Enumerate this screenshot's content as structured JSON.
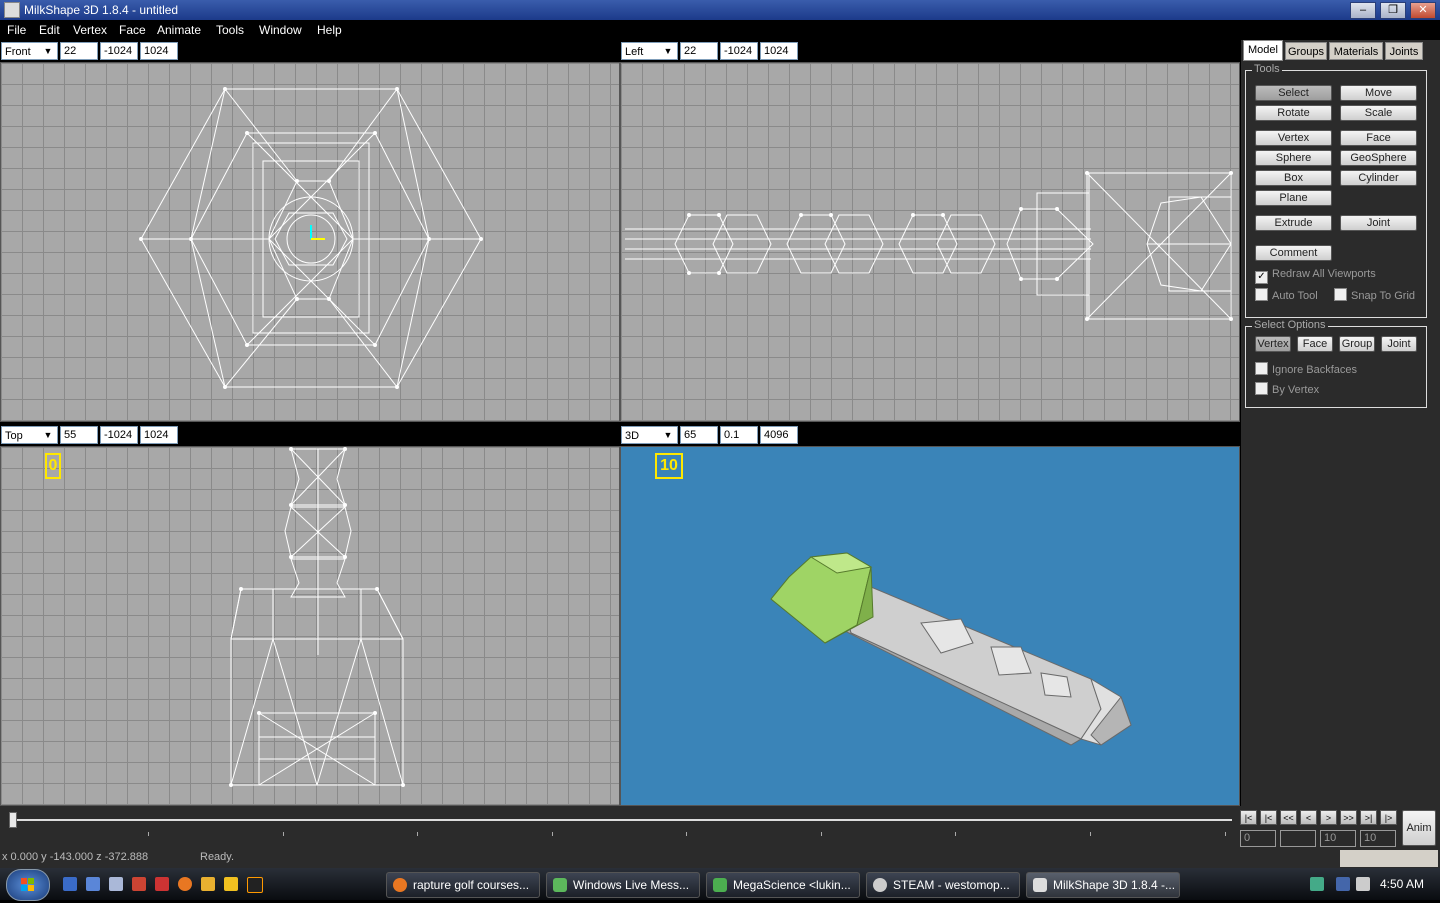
{
  "window": {
    "title": "MilkShape 3D 1.8.4 - untitled"
  },
  "menu": [
    "File",
    "Edit",
    "Vertex",
    "Face",
    "Animate",
    "Tools",
    "Window",
    "Help"
  ],
  "viewports": {
    "front": {
      "mode": "Front",
      "f1": "22",
      "f2": "-1024",
      "f3": "1024"
    },
    "left": {
      "mode": "Left",
      "f1": "22",
      "f2": "-1024",
      "f3": "1024"
    },
    "top": {
      "mode": "Top",
      "f1": "55",
      "f2": "-1024",
      "f3": "1024",
      "frame": "0"
    },
    "persp": {
      "mode": "3D",
      "f1": "65",
      "f2": "0.1",
      "f3": "4096",
      "frame": "10"
    }
  },
  "panel": {
    "tabs": [
      "Model",
      "Groups",
      "Materials",
      "Joints"
    ],
    "tools_label": "Tools",
    "tools": [
      "Select",
      "Move",
      "Rotate",
      "Scale",
      "Vertex",
      "Face",
      "Sphere",
      "GeoSphere",
      "Box",
      "Cylinder",
      "Plane",
      "Extrude",
      "Joint",
      "Comment"
    ],
    "checks": [
      "Redraw All Viewports",
      "Auto Tool",
      "Snap To Grid"
    ],
    "select_label": "Select Options",
    "select_buttons": [
      "Vertex",
      "Face",
      "Group",
      "Joint"
    ],
    "select_checks": [
      "Ignore Backfaces",
      "By Vertex"
    ]
  },
  "timeline": {
    "fields": [
      "0",
      "",
      "10",
      "10"
    ],
    "anim": "Anim",
    "buttons": [
      "|<",
      "|<",
      "<<",
      "<",
      ">",
      ">>",
      ">|",
      "|>"
    ]
  },
  "status": {
    "coords": "x 0.000 y -143.000 z -372.888",
    "msg": "Ready."
  },
  "taskbar": {
    "tasks": [
      "rapture golf courses...",
      "Windows Live Mess...",
      "MegaScience <lukin...",
      "STEAM - westomop...",
      "MilkShape 3D 1.8.4 -..."
    ],
    "clock": "4:50 AM"
  },
  "colors": {
    "viewport_grid": "#a8a8a8",
    "view3d": "#3a84b8",
    "frame_highlight": "#ffe800",
    "head_color": "#9fd465"
  }
}
